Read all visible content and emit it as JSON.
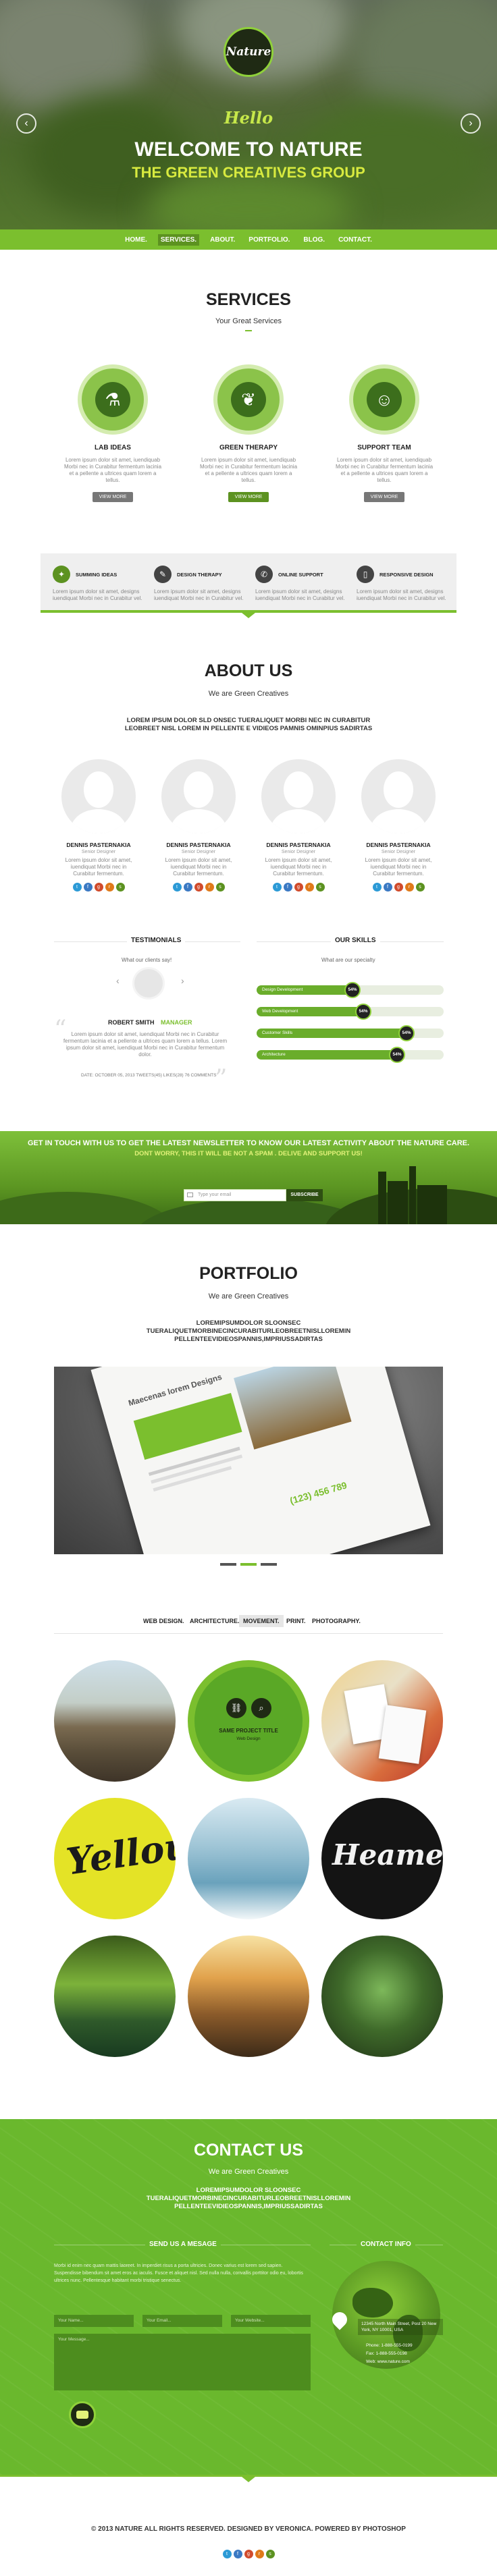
{
  "brand": {
    "logo_text": "Nature",
    "accent": "#7bbf2e",
    "dark": "#1f2a14"
  },
  "hero": {
    "hello": "Hello",
    "welcome": "WELCOME TO NATURE",
    "group": "THE GREEN CREATIVES GROUP",
    "prev": "‹",
    "next": "›"
  },
  "nav": [
    "HOME.",
    "SERVICES.",
    "ABOUT.",
    "PORTFOLIO.",
    "BLOG.",
    "CONTACT."
  ],
  "services": {
    "title": "SERVICES",
    "subtitle": "Your Great Services",
    "items": [
      {
        "title": "LAB IDEAS",
        "icon": "flask-icon",
        "glyph": "⚗",
        "text": "Lorem ipsum dolor sit amet, iuendiquab Morbi nec in Curabitur fermentum lacinia et a pellente a ultrices quam lorem a tellus.",
        "button": "VIEW MORE"
      },
      {
        "title": "GREEN THERAPY",
        "icon": "foot-icon",
        "glyph": "❦",
        "text": "Lorem ipsum dolor sit amet, iuendiquab Morbi nec in Curabitur fermentum lacinia et a pellente a ultrices quam lorem a tellus.",
        "button": "VIEW MORE"
      },
      {
        "title": "SUPPORT TEAM",
        "icon": "user-icon",
        "glyph": "☺",
        "text": "Lorem ipsum dolor sit amet, iuendiquab Morbi nec in Curabitur fermentum lacinia et a pellente a ultrices quam lorem a tellus.",
        "button": "VIEW MORE"
      }
    ],
    "features": [
      {
        "title": "SUMMING IDEAS",
        "icon": "bulb-icon",
        "glyph": "✦",
        "text": "Lorem ipsum dolor sit amet, designs iuendiquat Morbi nec in Curabitur vel."
      },
      {
        "title": "DESIGN THERAPY",
        "icon": "pencil-icon",
        "glyph": "✎",
        "text": "Lorem ipsum dolor sit amet, designs iuendiquat Morbi nec in Curabitur vel."
      },
      {
        "title": "ONLINE SUPPORT",
        "icon": "chat-icon",
        "glyph": "✆",
        "text": "Lorem ipsum dolor sit amet, designs iuendiquat Morbi nec in Curabitur vel."
      },
      {
        "title": "RESPONSIVE DESIGN",
        "icon": "phone-icon",
        "glyph": "▯",
        "text": "Lorem ipsum dolor sit amet, designs iuendiquat Morbi nec in Curabitur vel."
      }
    ]
  },
  "about": {
    "title": "ABOUT US",
    "subtitle": "We are Green Creatives",
    "lead": "LOREM  IPSUM DOLOR SLD ONSEC TUERALIQUET MORBI NEC IN CURABITUR LEOBREET NISL LOREM IN PELLENTE E VIDIEOS PAMNIS OMINPIUS SADIRTAS",
    "team": [
      {
        "name": "DENNIS PASTERNAKIA",
        "role": "Senior Designer",
        "text": "Lorem ipsum dolor sit amet, iuendiquat Morbi nec in Curabitur fermentum."
      },
      {
        "name": "DENNIS PASTERNAKIA",
        "role": "Senior Designer",
        "text": "Lorem ipsum dolor sit amet, iuendiquat Morbi nec in Curabitur fermentum."
      },
      {
        "name": "DENNIS PASTERNAKIA",
        "role": "Senior Designer",
        "text": "Lorem ipsum dolor sit amet, iuendiquat Morbi nec in Curabitur fermentum."
      },
      {
        "name": "DENNIS PASTERNAKIA",
        "role": "Senior Designer",
        "text": "Lorem ipsum dolor sit amet, iuendiquat Morbi nec in Curabitur fermentum."
      }
    ],
    "social_colors": [
      "#2c9ad6",
      "#3b79c3",
      "#d14b2c",
      "#e07a1a",
      "#5c9220"
    ],
    "testimonials": {
      "title": "TESTIMONIALS",
      "subtitle": "What our clients say!",
      "name": "ROBERT SMITH",
      "role": "MANAGER",
      "quote": "Lorem ipsum dolor sit amet, iuendiquat Morbi nec in Curabitur fermentum lacinia et a pellente a ultrices quam lorem a tellus. Lorem ipsum dolor sit amet, iuendiquat Morbi nec in Curabitur fermentum dolor.",
      "meta": "DATE: OCTOBER 05, 2013  TWEETS(45)  LIKES(28)  76 COMMENTS"
    },
    "skills": {
      "title": "OUR SKILLS",
      "subtitle": "What are our specialty",
      "items": [
        {
          "label": "Design Development",
          "percent": "54%",
          "level": 0.54
        },
        {
          "label": "Web Development",
          "percent": "54%",
          "level": 0.6
        },
        {
          "label": "Customer Skills",
          "percent": "54%",
          "level": 0.83
        },
        {
          "label": "Architecture",
          "percent": "54%",
          "level": 0.78
        }
      ]
    }
  },
  "newsletter": {
    "line1": "GET IN TOUCH WITH US TO GET THE LATEST NEWSLETTER  TO KNOW OUR LATEST ACTIVITY ABOUT THE NATURE CARE.",
    "line2": "DONT WORRY, THIS IT WILL BE NOT A SPAM . DELIVE AND SUPPORT US!",
    "placeholder": "Type your email",
    "button": "SUBSCRIBE"
  },
  "portfolio": {
    "title": "PORTFOLIO",
    "subtitle": "We are Green Creatives",
    "lead": "LOREMIPSUMDOLOR SLOONSEC TUERALIQUETMORBINECINCURABITURLEOBREETNISLLOREMIN PELLENTEEVIDIEOSPANNIS,IMPRIUSSADIRTAS",
    "mock_title": "Maecenas lorem Designs",
    "mock_phone": "(123) 456 789",
    "filters": [
      "WEB DESIGN.",
      "ARCHITECTURE.",
      "MOVEMENT.",
      "PRINT.",
      "PHOTOGRAPHY."
    ],
    "active_filter": 2,
    "overlay": {
      "title": "SAME PROJECT TITLE",
      "sub": "Web Design"
    },
    "items": [
      "mountain-photo",
      "project-overlay",
      "business-cards-photo",
      "yellow-lettering-art",
      "ice-photo",
      "heamer-lettering-art",
      "water-plants-photo",
      "sunset-field-photo",
      "mantis-photo"
    ]
  },
  "contact": {
    "title": "CONTACT US",
    "subtitle": "We are Green Creatives",
    "lead": "LOREMIPSUMDOLOR SLOONSEC TUERALIQUETMORBINECINCURABITURLEOBREETNISLLOREMIN PELLENTEEVIDIEOSPANNIS,IMPRIUSSADIRTAS",
    "form_title": "SEND US A MESAGE",
    "info_title": "CONTACT INFO",
    "form_text": "Morbi id enim nec quam mattis laoreet. In imperdiet risus a porta ultricies. Donec varius est lorem sed sapien. Suspendisse bibendum sit amet eros ac iaculis. Fusce et aliquet nisl. Sed nulla nulla, convallis porttitor odio eu, lobortis ultrices nunc. Pellentesque habitant morbi tristique senectus.",
    "name_ph": "Your Name...",
    "email_ph": "Your Email...",
    "site_ph": "Your Website...",
    "message_ph": "Your Message...",
    "address": "12345 North Main Street, Post 20 New York, NY 10001, USA",
    "phone": "Phone: 1-888-555-0199",
    "fax": "Fax: 1-888-555-0198",
    "web": "Web: www.nature.com"
  },
  "footer": {
    "copyright": "© 2013 NATURE ALL RIGHTS RESERVED. DESIGNED BY VERONICA. POWERED BY PHOTOSHOP"
  }
}
